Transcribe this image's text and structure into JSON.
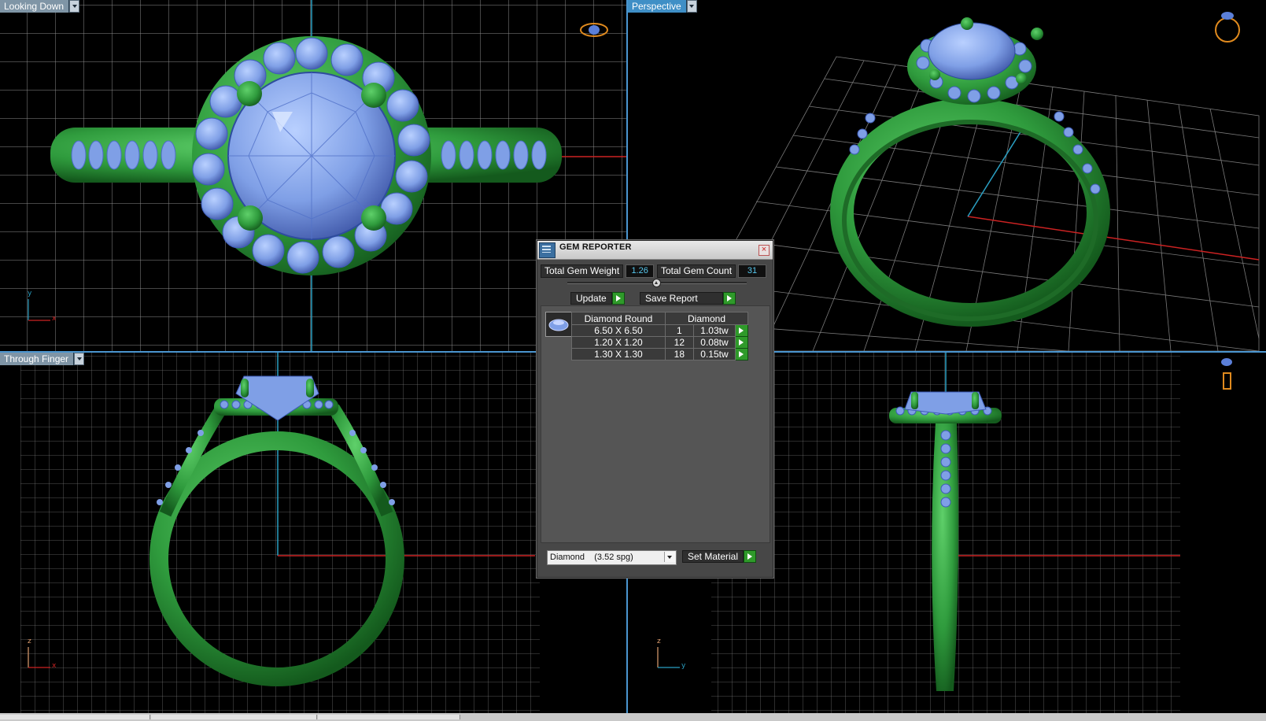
{
  "viewports": {
    "top_left": {
      "label": "Looking Down",
      "axis_v": "y",
      "axis_h": "x"
    },
    "top_right": {
      "label": "Perspective"
    },
    "bottom_left": {
      "label": "Through Finger",
      "axis_v": "z",
      "axis_h": "x"
    },
    "bottom_right": {
      "axis_v": "z",
      "axis_h": "y"
    }
  },
  "gem_reporter": {
    "title": "GEM REPORTER",
    "total_weight_label": "Total Gem Weight",
    "total_weight_value": "1.26",
    "total_count_label": "Total Gem Count",
    "total_count_value": "31",
    "update_label": "Update",
    "save_report_label": "Save Report",
    "table": {
      "headers": [
        "Diamond Round",
        "Diamond"
      ],
      "rows": [
        {
          "size": "6.50 X 6.50",
          "count": "1",
          "weight": "1.03tw"
        },
        {
          "size": "1.20 X 1.20",
          "count": "12",
          "weight": "0.08tw"
        },
        {
          "size": "1.30 X 1.30",
          "count": "18",
          "weight": "0.15tw"
        }
      ]
    },
    "material_value": "Diamond    (3.52 spg)",
    "set_material_label": "Set Material"
  },
  "colors": {
    "metal": "#2f9b3d",
    "gem": "#7f9fe6",
    "grid": "#8a8a8a",
    "axis_x": "#cc2222",
    "axis_y": "#2a9fc2"
  }
}
